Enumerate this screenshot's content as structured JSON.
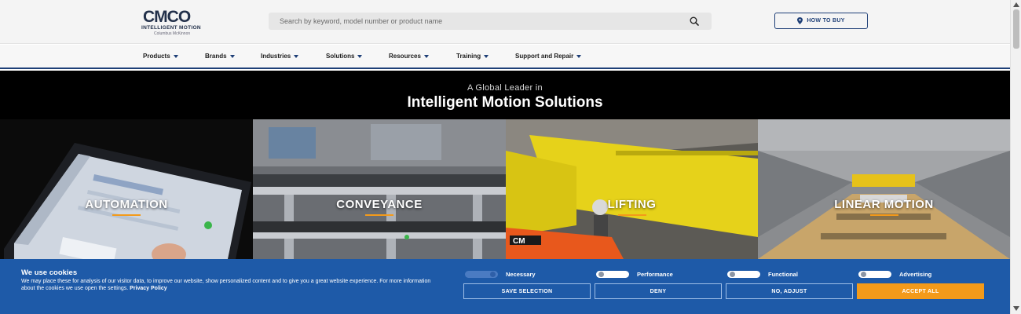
{
  "header": {
    "logo": {
      "wordmark": "CMCO",
      "line1": "INTELLIGENT MOTION",
      "line2": "Columbus McKinnon"
    },
    "search": {
      "placeholder": "Search by keyword, model number or product name"
    },
    "how_to_buy": "HOW TO BUY"
  },
  "nav": {
    "items": [
      "Products",
      "Brands",
      "Industries",
      "Solutions",
      "Resources",
      "Training",
      "Support and Repair"
    ]
  },
  "hero": {
    "kicker": "A Global Leader in",
    "title": "Intelligent Motion Solutions",
    "panels": [
      {
        "label": "AUTOMATION"
      },
      {
        "label": "CONVEYANCE"
      },
      {
        "label": "LIFTING"
      },
      {
        "label": "LINEAR MOTION"
      }
    ]
  },
  "cookie": {
    "title": "We use cookies",
    "text": "We may place these for analysis of our visitor data, to improve our website, show personalized content and to give you a great website experience. For more information about the cookies we use open the settings.",
    "policy_link": "Privacy Policy",
    "toggles": [
      {
        "label": "Necessary",
        "state": "on"
      },
      {
        "label": "Performance",
        "state": "off"
      },
      {
        "label": "Functional",
        "state": "off"
      },
      {
        "label": "Advertising",
        "state": "off"
      }
    ],
    "buttons": {
      "save": "SAVE SELECTION",
      "deny": "DENY",
      "adjust": "NO, ADJUST",
      "accept": "ACCEPT ALL"
    }
  },
  "colors": {
    "brand_navy": "#1e3f77",
    "cookie_blue": "#1e5aa8",
    "accent_orange": "#f39a1a"
  }
}
